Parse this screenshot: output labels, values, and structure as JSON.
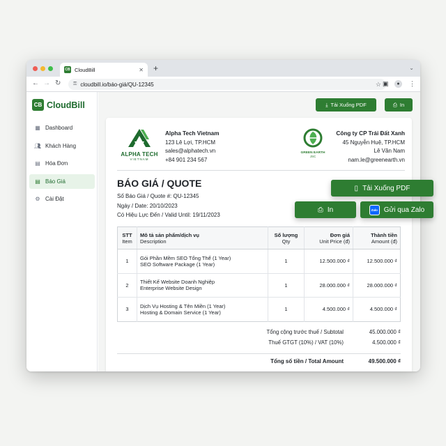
{
  "browser": {
    "tab_title": "CloudBill",
    "url": "cloudbill.io/báo-giá/QU-12345"
  },
  "app": {
    "logo_initials": "CB",
    "logo_name": "CloudBill"
  },
  "sidebar": {
    "items": [
      {
        "label": "Dashboard",
        "icon": "grid-icon"
      },
      {
        "label": "Khách Hàng",
        "icon": "users-icon"
      },
      {
        "label": "Hóa Đơn",
        "icon": "document-icon"
      },
      {
        "label": "Báo Giá",
        "icon": "quote-document-icon",
        "active": true
      },
      {
        "label": "Cài Đặt",
        "icon": "gear-icon"
      }
    ]
  },
  "toolbar": {
    "download_pdf": "Tải Xuống PDF",
    "print": "In"
  },
  "quote": {
    "seller": {
      "logo_text": "ALPHA TECH",
      "logo_sub": "VIETNAM",
      "name": "Alpha Tech Vietnam",
      "address": "123 Lê Lợi, TP.HCM",
      "email": "sales@alphatech.vn",
      "phone": "+84 901 234 567"
    },
    "buyer": {
      "logo_text": "GREEN EARTH",
      "logo_sub": "JSC",
      "name": "Công ty CP Trái Đất Xanh",
      "address": "45 Nguyễn Huệ, TP.HCM",
      "contact": "Lê Văn Nam",
      "email": "nam.le@greenearth.vn"
    },
    "title": "BÁO GIÁ / QUOTE",
    "number_line": "Số Báo Giá / Quote #: QU-12345",
    "date_line": "Ngày / Date: 20/10/2023",
    "valid_line": "Có Hiệu Lực Đến / Valid Until: 19/11/2023",
    "columns": {
      "stt": "STT",
      "stt_en": "Item",
      "desc": "Mô tả sản phẩm/dịch vụ",
      "desc_en": "Description",
      "qty": "Số lượng",
      "qty_en": "Qty",
      "price": "Đơn giá",
      "price_en": "Unit Price (đ)",
      "amount": "Thành tiền",
      "amount_en": "Amount (đ)"
    },
    "items": [
      {
        "no": "1",
        "desc": "Gói Phần Mềm SEO Tổng Thể (1 Year)",
        "desc_en": "SEO Software Package (1 Year)",
        "qty": "1",
        "price": "12.500.000 ₫",
        "amount": "12.500.000 ₫"
      },
      {
        "no": "2",
        "desc": "Thiết Kế Website Doanh Nghiệp",
        "desc_en": "Enterprise Website Design",
        "qty": "1",
        "price": "28.000.000 ₫",
        "amount": "28.000.000 ₫"
      },
      {
        "no": "3",
        "desc": "Dịch Vụ Hosting & Tên Miền (1 Year)",
        "desc_en": "Hosting & Domain Service (1 Year)",
        "qty": "1",
        "price": "4.500.000 ₫",
        "amount": "4.500.000 ₫"
      }
    ],
    "subtotal_label": "Tổng cộng trước thuế / Subtotal",
    "subtotal": "45.000.000 ₫",
    "vat_label": "Thuế GTGT (10%) / VAT (10%)",
    "vat": "4.500.000 ₫",
    "total_label": "Tổng số tiền / Total Amount",
    "total": "49.500.000 ₫"
  },
  "floating_actions": {
    "download_pdf": "Tải Xuống PDF",
    "print": "In",
    "zalo_badge": "Zalo",
    "send_zalo": "Gửi qua Zalo"
  },
  "colors": {
    "brand_green": "#2e7d32",
    "zalo_blue": "#0a68ff"
  }
}
